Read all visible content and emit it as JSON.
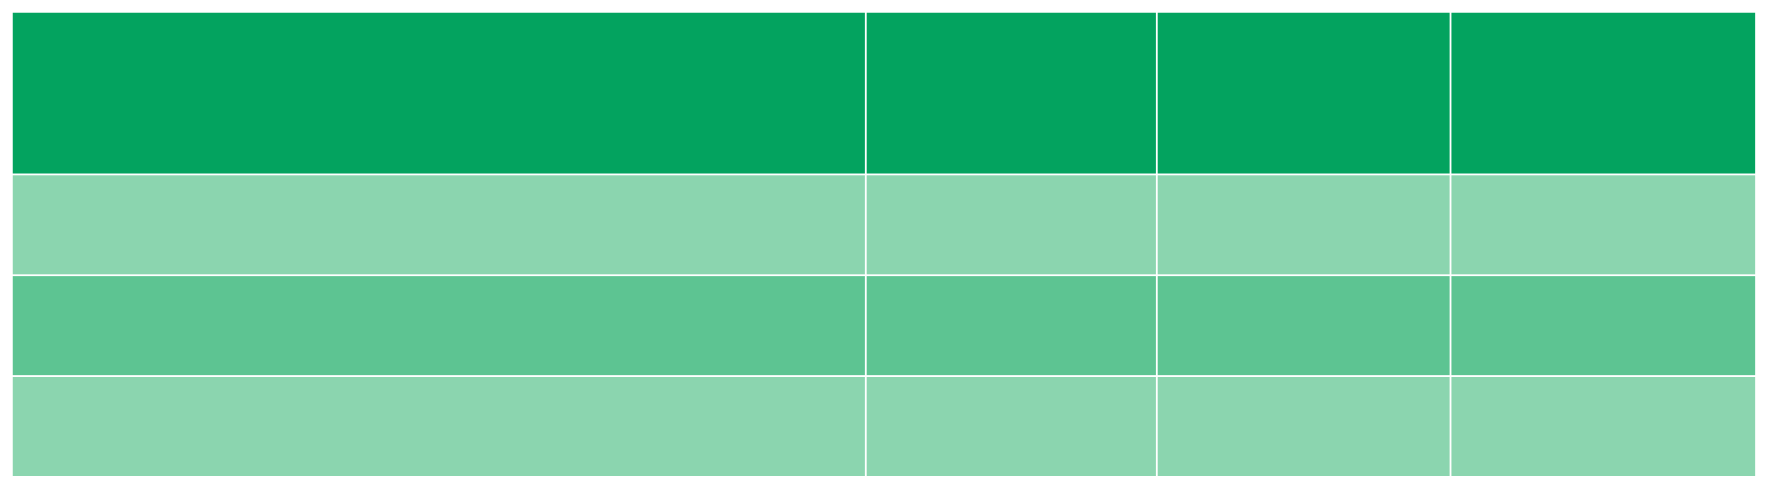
{
  "colors": {
    "header": "#03A35F",
    "row_light": "#8BD5AF",
    "row_medium": "#5DC492",
    "gridline": "#FFFFFF",
    "background": "#FFFFFF"
  },
  "table": {
    "header": [
      "",
      "",
      "",
      ""
    ],
    "rows": [
      {
        "tone": "row_light",
        "cells": [
          "",
          "",
          "",
          ""
        ]
      },
      {
        "tone": "row_medium",
        "cells": [
          "",
          "",
          "",
          ""
        ]
      },
      {
        "tone": "row_light",
        "cells": [
          "",
          "",
          "",
          ""
        ]
      }
    ]
  }
}
